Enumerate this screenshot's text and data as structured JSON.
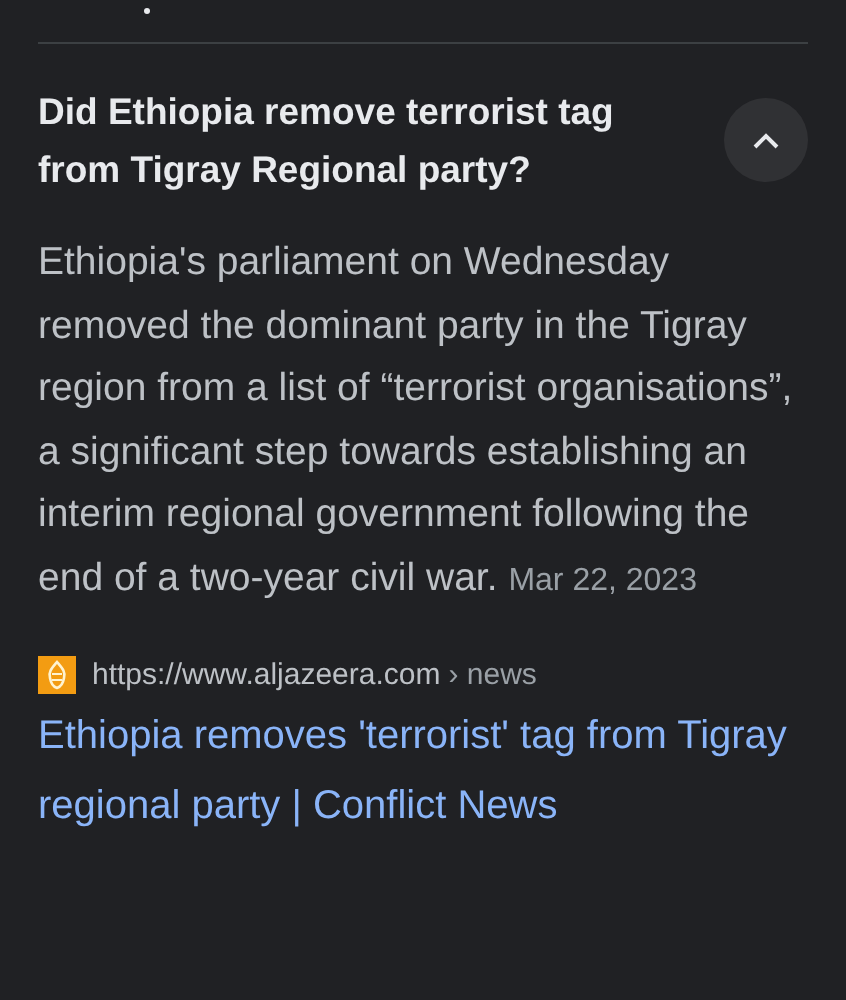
{
  "question": {
    "text": "Did Ethiopia remove terrorist tag from Tigray Regional party?",
    "expanded": true
  },
  "answer": {
    "text": "Ethiopia's parliament on Wednesday removed the dominant party in the Tigray region from a list of “terrorist organisations”, a significant step towards establishing an interim regional government following the end of a two-year civil war.",
    "date": "Mar 22, 2023"
  },
  "source": {
    "url": "https://www.aljazeera.com",
    "path": "› news"
  },
  "result_title": "Ethiopia removes 'terrorist' tag from Tigray regional party | Conflict News"
}
